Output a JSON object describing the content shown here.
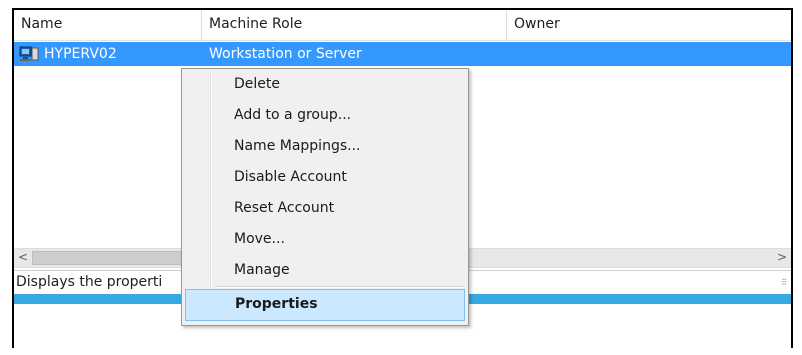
{
  "columns": {
    "name": "Name",
    "role": "Machine Role",
    "owner": "Owner"
  },
  "selected_row": {
    "name": "HYPERV02",
    "role": "Workstation or Server",
    "owner": "",
    "icon": "computer-icon"
  },
  "scrollbar": {
    "left_arrow": "<",
    "right_arrow": ">"
  },
  "status": {
    "text": "Displays the properti"
  },
  "context_menu": {
    "items": [
      {
        "label": "Delete"
      },
      {
        "label": "Add to a group..."
      },
      {
        "label": "Name Mappings..."
      },
      {
        "label": "Disable Account"
      },
      {
        "label": "Reset Account"
      },
      {
        "label": "Move..."
      },
      {
        "label": "Manage"
      },
      {
        "label": "Properties",
        "highlighted": true
      }
    ]
  },
  "colors": {
    "selection": "#3399ff",
    "menu_highlight": "#cce8ff",
    "band": "#36a9e1"
  }
}
